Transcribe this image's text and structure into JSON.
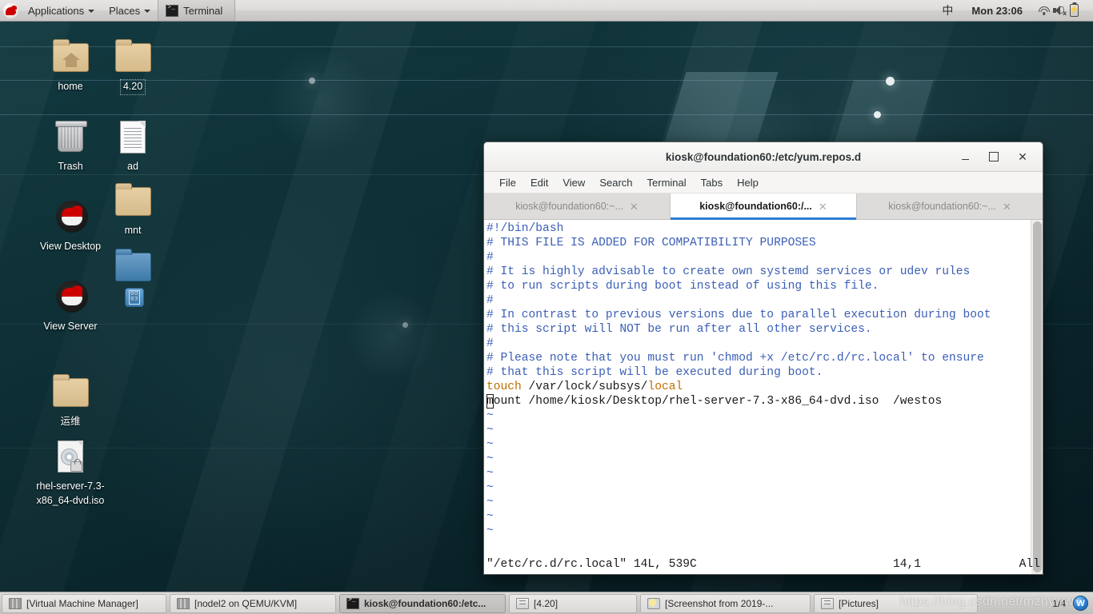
{
  "top_panel": {
    "logo": "redhat-shadowman-logo",
    "applications_label": "Applications",
    "places_label": "Places",
    "active_app_label": "Terminal",
    "ime_label": "中",
    "clock": "Mon 23:06",
    "icons": [
      "wifi-icon",
      "volume-muted-icon",
      "battery-charging-icon",
      "dropdown-arrow-icon"
    ]
  },
  "desktop_icons": [
    {
      "label": "home",
      "type": "folder-home"
    },
    {
      "label": "4.20",
      "type": "folder",
      "boxed": true
    },
    {
      "label": "Trash",
      "type": "trash"
    },
    {
      "label": "ad",
      "type": "document"
    },
    {
      "label": "View Desktop",
      "type": "redhat"
    },
    {
      "label": "mnt",
      "type": "folder"
    },
    {
      "label": "",
      "type": "folder-blue"
    },
    {
      "label": "",
      "type": "binary-app"
    },
    {
      "label": "View Server",
      "type": "redhat"
    },
    {
      "label": "运维",
      "type": "folder"
    },
    {
      "label": "rhel-server-7.3-x86_64-dvd.iso",
      "type": "iso-locked"
    }
  ],
  "terminal": {
    "title": "kiosk@foundation60:/etc/yum.repos.d",
    "window_buttons": {
      "minimize": "_",
      "maximize": "□",
      "close": "✕"
    },
    "menus": [
      "File",
      "Edit",
      "View",
      "Search",
      "Terminal",
      "Tabs",
      "Help"
    ],
    "tabs": [
      {
        "label": "kiosk@foundation60:~...",
        "active": false,
        "close": "✕"
      },
      {
        "label": "kiosk@foundation60:/...",
        "active": true,
        "close": "✕"
      },
      {
        "label": "kiosk@foundation60:~...",
        "active": false,
        "close": "✕"
      }
    ],
    "editor_lines": [
      [
        {
          "t": "#!/bin/bash",
          "c": "comment"
        }
      ],
      [
        {
          "t": "# THIS FILE IS ADDED FOR COMPATIBILITY PURPOSES",
          "c": "comment"
        }
      ],
      [
        {
          "t": "#",
          "c": "comment"
        }
      ],
      [
        {
          "t": "# It is highly advisable to create own systemd services or udev rules",
          "c": "comment"
        }
      ],
      [
        {
          "t": "# to run scripts during boot instead of using this file.",
          "c": "comment"
        }
      ],
      [
        {
          "t": "#",
          "c": "comment"
        }
      ],
      [
        {
          "t": "# In contrast to previous versions due to parallel execution during boot",
          "c": "comment"
        }
      ],
      [
        {
          "t": "# this script will NOT be run after all other services.",
          "c": "comment"
        }
      ],
      [
        {
          "t": "#",
          "c": "comment"
        }
      ],
      [
        {
          "t": "# Please note that you must run 'chmod +x /etc/rc.d/rc.local' to ensure",
          "c": "comment"
        }
      ],
      [
        {
          "t": "# that this script will be executed during boot.",
          "c": "comment"
        }
      ],
      [
        {
          "t": "",
          "c": "plain"
        }
      ],
      [
        {
          "t": "touch",
          "c": "kw"
        },
        {
          "t": " /var/lock/subsys/",
          "c": "plain"
        },
        {
          "t": "local",
          "c": "kw"
        }
      ],
      [
        {
          "t": "m",
          "c": "cursor"
        },
        {
          "t": "ount /home/kiosk/Desktop/rhel-server-7.3-x86_64-dvd.iso  /westos",
          "c": "plain"
        }
      ]
    ],
    "tilde_count": 9,
    "status_file": "\"/etc/rc.d/rc.local\" 14L, 539C",
    "status_pos": "14,1",
    "status_scroll": "All"
  },
  "taskbar": {
    "buttons": [
      {
        "label": "[Virtual Machine Manager]",
        "icon": "vmm-icon",
        "active": false
      },
      {
        "label": "[nodel2 on QEMU/KVM]",
        "icon": "vmm-icon",
        "active": false
      },
      {
        "label": "kiosk@foundation60:/etc...",
        "icon": "terminal-icon",
        "active": true
      },
      {
        "label": "[4.20]",
        "icon": "file-manager-icon",
        "active": false
      },
      {
        "label": "[Screenshot from 2019-...",
        "icon": "image-viewer-icon",
        "active": false
      },
      {
        "label": "[Pictures]",
        "icon": "file-manager-icon",
        "active": false
      }
    ],
    "workspace": "1/4",
    "orb": "W"
  },
  "watermark": "https://blog.csdn.net/mzhyww",
  "colors": {
    "accent_blue": "#2a7fd4",
    "comment_blue": "#3b5fb5",
    "keyword_orange": "#c07000",
    "desktop_teal": "#0e3137",
    "panel_gray": "#d2d0ce"
  }
}
